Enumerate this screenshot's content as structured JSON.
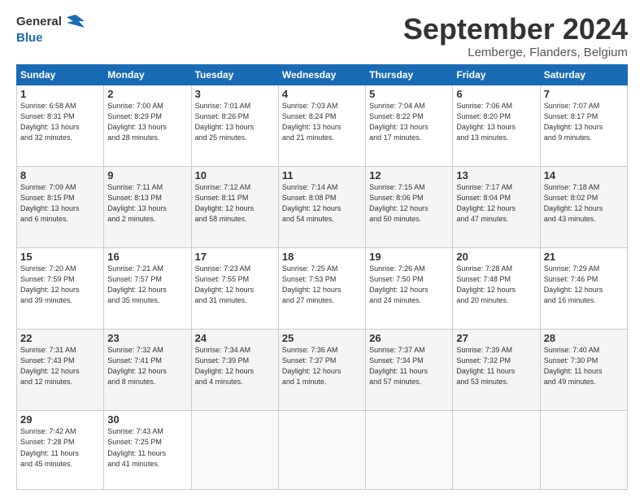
{
  "header": {
    "logo_line1": "General",
    "logo_line2": "Blue",
    "month_title": "September 2024",
    "location": "Lemberge, Flanders, Belgium"
  },
  "weekdays": [
    "Sunday",
    "Monday",
    "Tuesday",
    "Wednesday",
    "Thursday",
    "Friday",
    "Saturday"
  ],
  "weeks": [
    [
      {
        "day": "1",
        "info": "Sunrise: 6:58 AM\nSunset: 8:31 PM\nDaylight: 13 hours\nand 32 minutes."
      },
      {
        "day": "2",
        "info": "Sunrise: 7:00 AM\nSunset: 8:29 PM\nDaylight: 13 hours\nand 28 minutes."
      },
      {
        "day": "3",
        "info": "Sunrise: 7:01 AM\nSunset: 8:26 PM\nDaylight: 13 hours\nand 25 minutes."
      },
      {
        "day": "4",
        "info": "Sunrise: 7:03 AM\nSunset: 8:24 PM\nDaylight: 13 hours\nand 21 minutes."
      },
      {
        "day": "5",
        "info": "Sunrise: 7:04 AM\nSunset: 8:22 PM\nDaylight: 13 hours\nand 17 minutes."
      },
      {
        "day": "6",
        "info": "Sunrise: 7:06 AM\nSunset: 8:20 PM\nDaylight: 13 hours\nand 13 minutes."
      },
      {
        "day": "7",
        "info": "Sunrise: 7:07 AM\nSunset: 8:17 PM\nDaylight: 13 hours\nand 9 minutes."
      }
    ],
    [
      {
        "day": "8",
        "info": "Sunrise: 7:09 AM\nSunset: 8:15 PM\nDaylight: 13 hours\nand 6 minutes."
      },
      {
        "day": "9",
        "info": "Sunrise: 7:11 AM\nSunset: 8:13 PM\nDaylight: 13 hours\nand 2 minutes."
      },
      {
        "day": "10",
        "info": "Sunrise: 7:12 AM\nSunset: 8:11 PM\nDaylight: 12 hours\nand 58 minutes."
      },
      {
        "day": "11",
        "info": "Sunrise: 7:14 AM\nSunset: 8:08 PM\nDaylight: 12 hours\nand 54 minutes."
      },
      {
        "day": "12",
        "info": "Sunrise: 7:15 AM\nSunset: 8:06 PM\nDaylight: 12 hours\nand 50 minutes."
      },
      {
        "day": "13",
        "info": "Sunrise: 7:17 AM\nSunset: 8:04 PM\nDaylight: 12 hours\nand 47 minutes."
      },
      {
        "day": "14",
        "info": "Sunrise: 7:18 AM\nSunset: 8:02 PM\nDaylight: 12 hours\nand 43 minutes."
      }
    ],
    [
      {
        "day": "15",
        "info": "Sunrise: 7:20 AM\nSunset: 7:59 PM\nDaylight: 12 hours\nand 39 minutes."
      },
      {
        "day": "16",
        "info": "Sunrise: 7:21 AM\nSunset: 7:57 PM\nDaylight: 12 hours\nand 35 minutes."
      },
      {
        "day": "17",
        "info": "Sunrise: 7:23 AM\nSunset: 7:55 PM\nDaylight: 12 hours\nand 31 minutes."
      },
      {
        "day": "18",
        "info": "Sunrise: 7:25 AM\nSunset: 7:53 PM\nDaylight: 12 hours\nand 27 minutes."
      },
      {
        "day": "19",
        "info": "Sunrise: 7:26 AM\nSunset: 7:50 PM\nDaylight: 12 hours\nand 24 minutes."
      },
      {
        "day": "20",
        "info": "Sunrise: 7:28 AM\nSunset: 7:48 PM\nDaylight: 12 hours\nand 20 minutes."
      },
      {
        "day": "21",
        "info": "Sunrise: 7:29 AM\nSunset: 7:46 PM\nDaylight: 12 hours\nand 16 minutes."
      }
    ],
    [
      {
        "day": "22",
        "info": "Sunrise: 7:31 AM\nSunset: 7:43 PM\nDaylight: 12 hours\nand 12 minutes."
      },
      {
        "day": "23",
        "info": "Sunrise: 7:32 AM\nSunset: 7:41 PM\nDaylight: 12 hours\nand 8 minutes."
      },
      {
        "day": "24",
        "info": "Sunrise: 7:34 AM\nSunset: 7:39 PM\nDaylight: 12 hours\nand 4 minutes."
      },
      {
        "day": "25",
        "info": "Sunrise: 7:36 AM\nSunset: 7:37 PM\nDaylight: 12 hours\nand 1 minute."
      },
      {
        "day": "26",
        "info": "Sunrise: 7:37 AM\nSunset: 7:34 PM\nDaylight: 11 hours\nand 57 minutes."
      },
      {
        "day": "27",
        "info": "Sunrise: 7:39 AM\nSunset: 7:32 PM\nDaylight: 11 hours\nand 53 minutes."
      },
      {
        "day": "28",
        "info": "Sunrise: 7:40 AM\nSunset: 7:30 PM\nDaylight: 11 hours\nand 49 minutes."
      }
    ],
    [
      {
        "day": "29",
        "info": "Sunrise: 7:42 AM\nSunset: 7:28 PM\nDaylight: 11 hours\nand 45 minutes."
      },
      {
        "day": "30",
        "info": "Sunrise: 7:43 AM\nSunset: 7:25 PM\nDaylight: 11 hours\nand 41 minutes."
      },
      {
        "day": "",
        "info": ""
      },
      {
        "day": "",
        "info": ""
      },
      {
        "day": "",
        "info": ""
      },
      {
        "day": "",
        "info": ""
      },
      {
        "day": "",
        "info": ""
      }
    ]
  ]
}
